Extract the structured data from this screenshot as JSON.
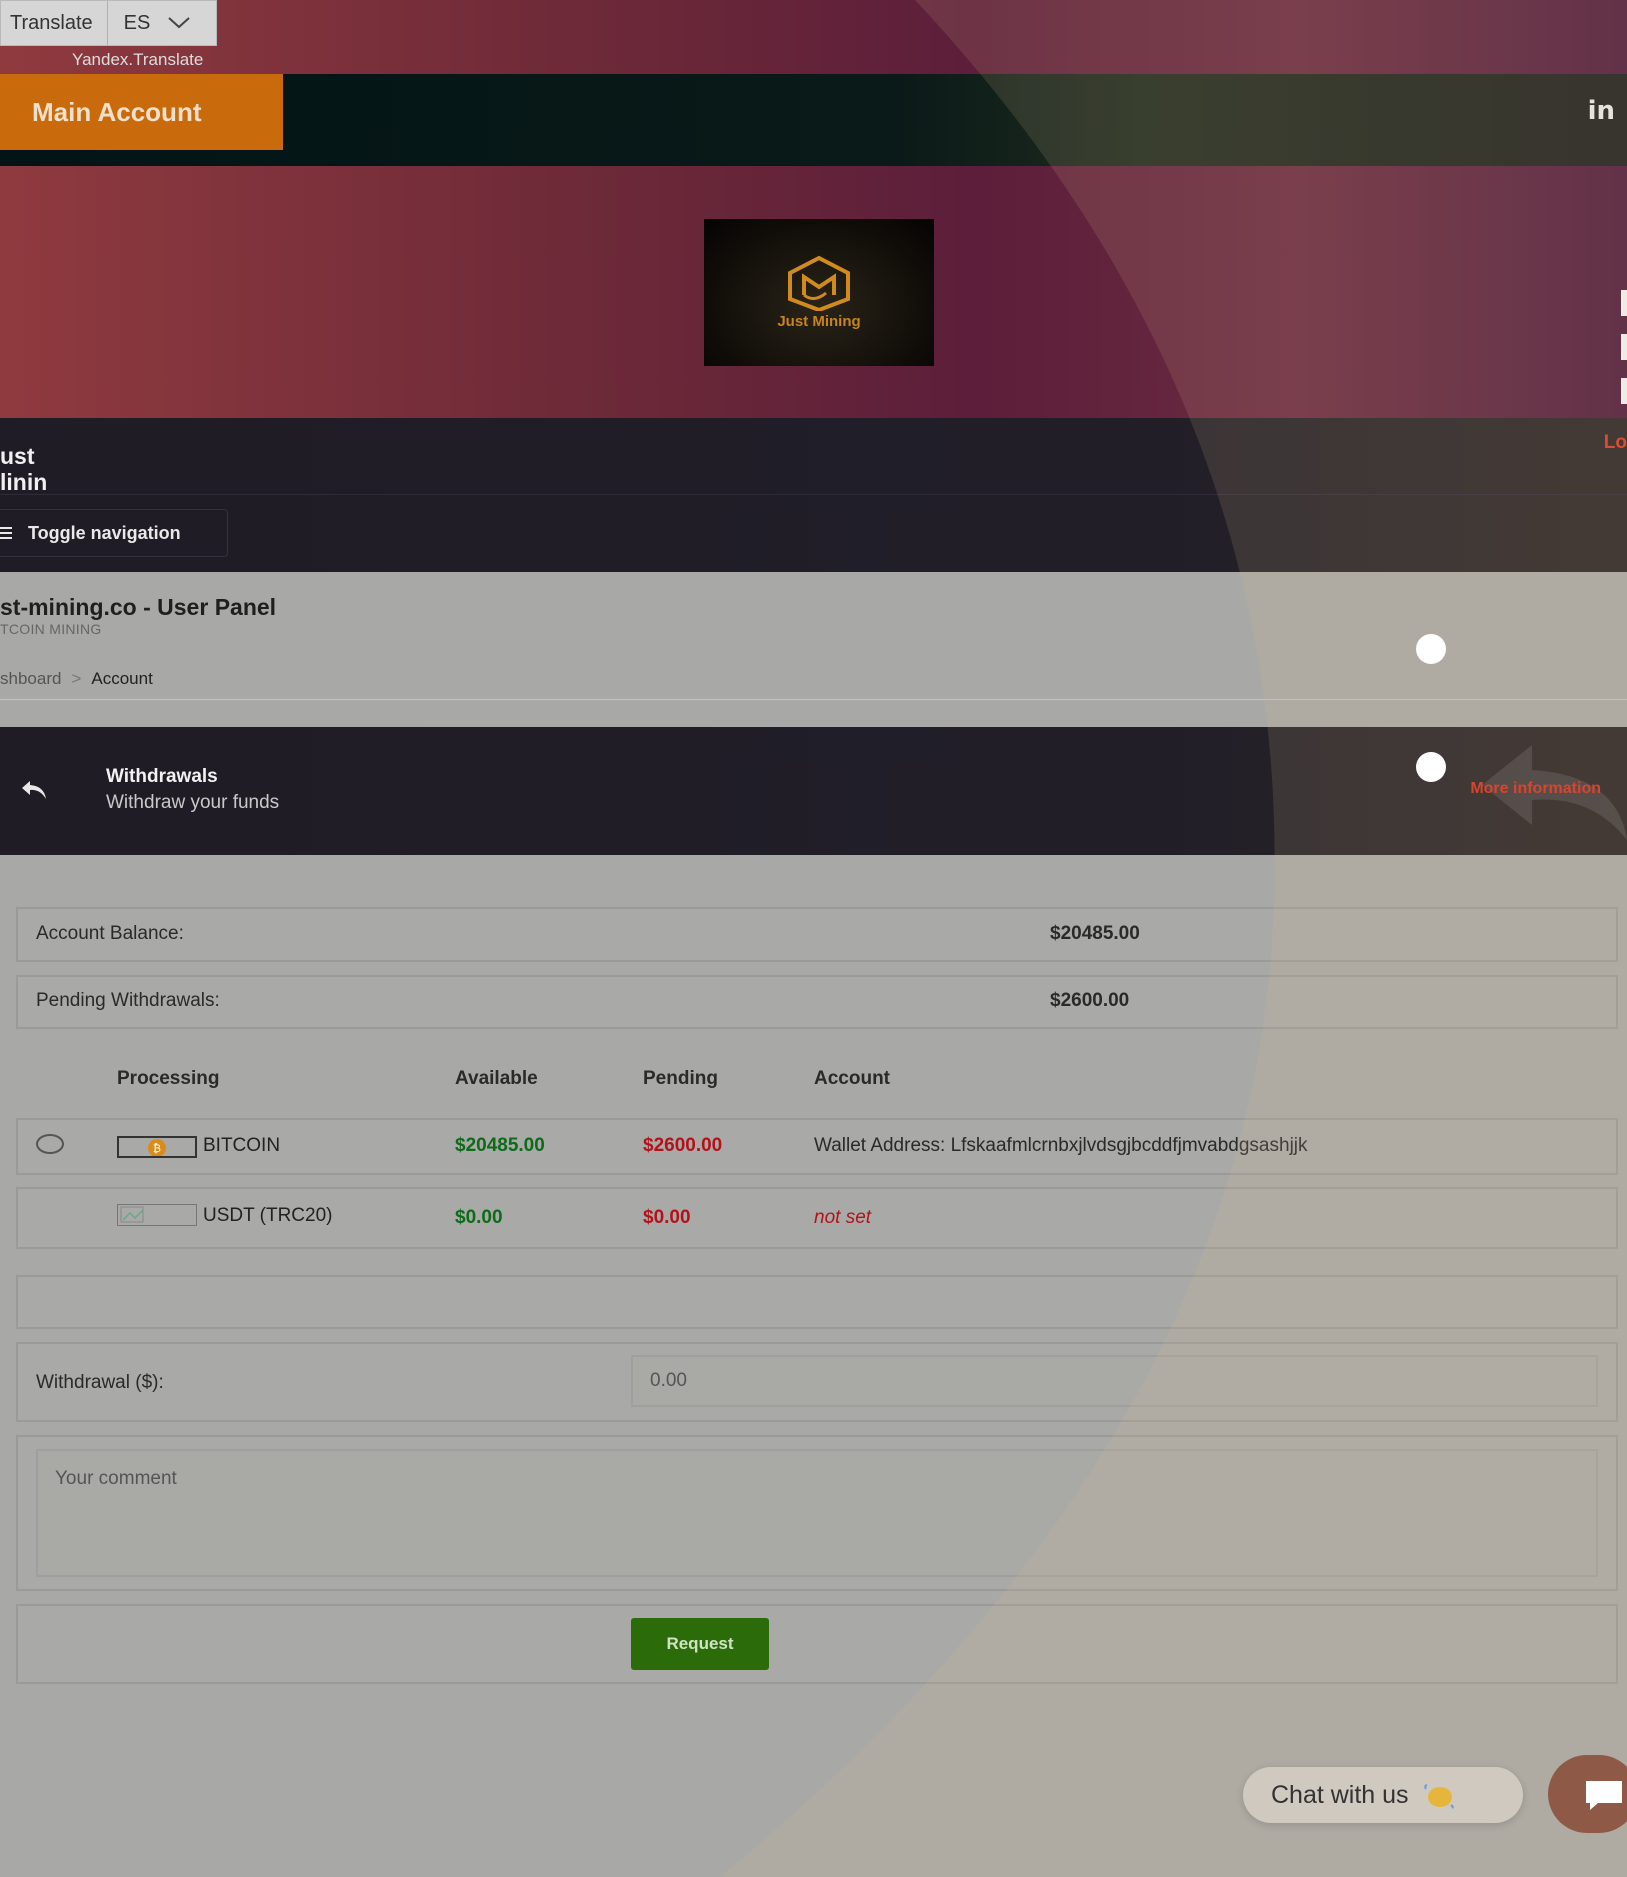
{
  "translate": {
    "button_label": "Translate",
    "language": "ES",
    "provider": "Yandex.Translate"
  },
  "header": {
    "main_account": "Main Account",
    "social": "in",
    "logo_text": "Just Mining",
    "brand_line1": "ust",
    "brand_line2": "linin",
    "right_link": "Lo",
    "toggle_nav": "Toggle navigation"
  },
  "page": {
    "title": "st-mining.co - User Panel",
    "subtitle": "TCOIN MINING",
    "breadcrumb": {
      "parent": "shboard",
      "separator": ">",
      "current": "Account"
    }
  },
  "withdrawals_box": {
    "title": "Withdrawals",
    "subtitle": "Withdraw your funds",
    "more_info": "More information"
  },
  "summary": {
    "balance_label": "Account Balance:",
    "balance_value": "$20485.00",
    "pending_label": "Pending Withdrawals:",
    "pending_value": "$2600.00"
  },
  "table": {
    "headers": {
      "processing": "Processing",
      "available": "Available",
      "pending": "Pending",
      "account": "Account"
    },
    "rows": [
      {
        "name": "BITCOIN",
        "available": "$20485.00",
        "pending": "$2600.00",
        "account": "Wallet Address: Lfskaafmlcrnbxjlvdsgjbcddfjmvabdgsashjjk"
      },
      {
        "name": "USDT (TRC20)",
        "available": "$0.00",
        "pending": "$0.00",
        "account": "not set"
      }
    ]
  },
  "form": {
    "withdrawal_label": "Withdrawal ($):",
    "amount_value": "0.00",
    "comment_placeholder": "Your comment",
    "request_button": "Request"
  },
  "chat": {
    "label": "Chat with us"
  },
  "colors": {
    "accent_orange": "#c96a0c",
    "request_green": "#2c6b0a",
    "available_green": "#0d6b1a",
    "pending_red": "#b3121b",
    "more_info_red": "#d8321f"
  }
}
